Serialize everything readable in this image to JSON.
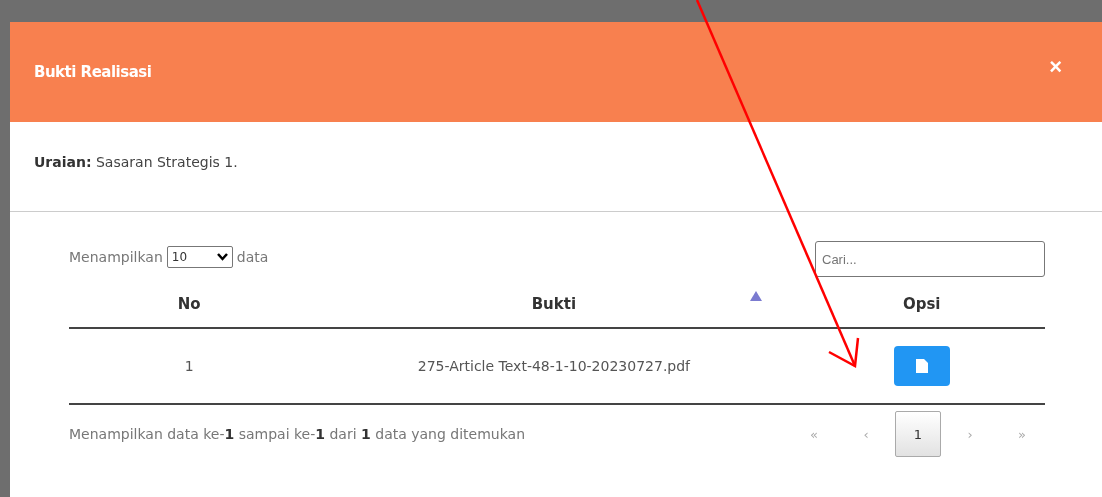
{
  "modal": {
    "title": "Bukti Realisasi",
    "close": "×"
  },
  "description": {
    "label": "Uraian:",
    "value": "Sasaran Strategis 1."
  },
  "length_menu": {
    "before": "Menampilkan",
    "value": "10",
    "after": "data"
  },
  "search": {
    "placeholder": "Cari..."
  },
  "table": {
    "columns": [
      {
        "label": "No",
        "sorted": false
      },
      {
        "label": "Bukti",
        "sorted": true
      },
      {
        "label": "Opsi",
        "sorted": false
      }
    ],
    "rows": [
      {
        "no": "1",
        "file": "275-Article Text-48-1-10-20230727.pdf"
      }
    ]
  },
  "info": "Menampilkan data ke-**1** sampai ke-**1** dari **1** data yang ditemukan",
  "pagination": [
    {
      "label": "«",
      "selected": false
    },
    {
      "label": "‹",
      "selected": false
    },
    {
      "label": "1",
      "selected": true
    },
    {
      "label": "›",
      "selected": false
    },
    {
      "label": "»",
      "selected": false
    }
  ]
}
